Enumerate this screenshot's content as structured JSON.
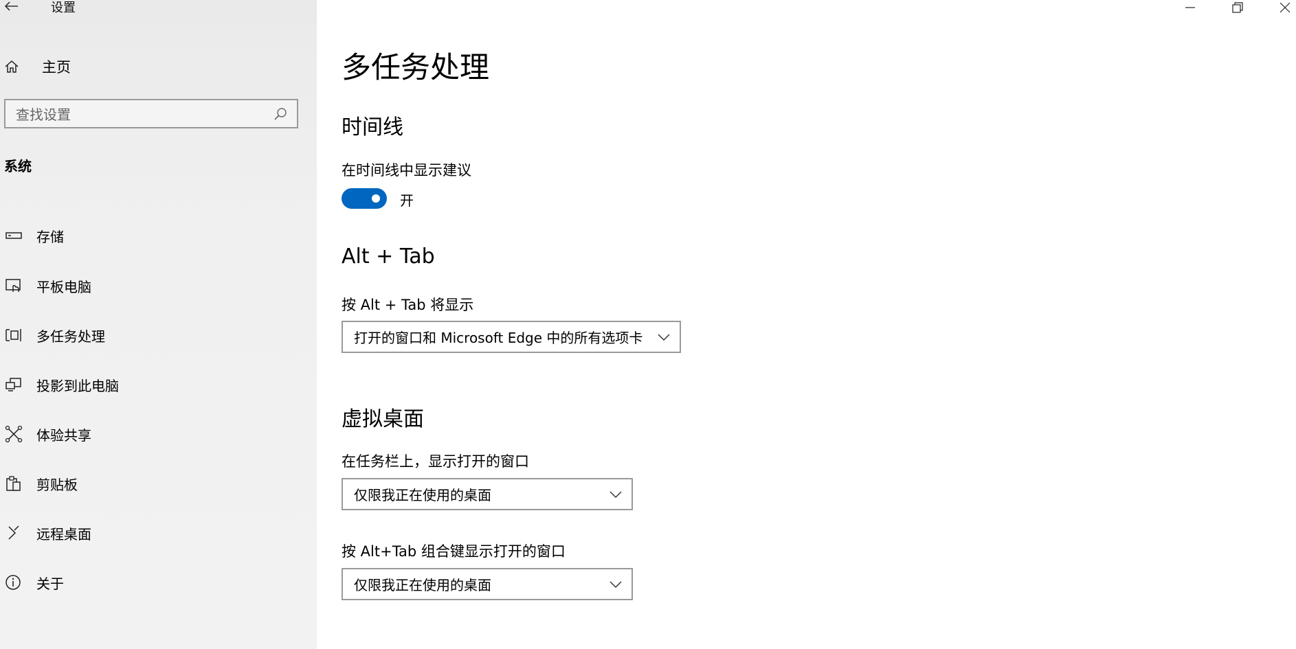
{
  "window": {
    "title": "设置",
    "controls": [
      "minimize-icon",
      "restore-icon",
      "close-icon"
    ]
  },
  "sidebar": {
    "home_label": "主页",
    "search_placeholder": "查找设置",
    "section_label": "系统",
    "items": [
      {
        "label": "存储",
        "icon": "storage-icon"
      },
      {
        "label": "平板电脑",
        "icon": "tablet-icon"
      },
      {
        "label": "多任务处理",
        "icon": "multitasking-icon"
      },
      {
        "label": "投影到此电脑",
        "icon": "project-icon"
      },
      {
        "label": "体验共享",
        "icon": "shared-experiences-icon"
      },
      {
        "label": "剪贴板",
        "icon": "clipboard-icon"
      },
      {
        "label": "远程桌面",
        "icon": "remote-desktop-icon"
      },
      {
        "label": "关于",
        "icon": "info-icon"
      }
    ]
  },
  "main": {
    "page_title": "多任务处理",
    "timeline": {
      "heading": "时间线",
      "suggestions_label": "在时间线中显示建议",
      "toggle_on": true,
      "toggle_state": "开",
      "accent_color": "#0067c0"
    },
    "alt_tab": {
      "heading": "Alt + Tab",
      "label": "按 Alt + Tab 将显示",
      "selected": "打开的窗口和 Microsoft Edge 中的所有选项卡"
    },
    "virtual_desktops": {
      "heading": "虚拟桌面",
      "taskbar_label": "在任务栏上，显示打开的窗口",
      "taskbar_selected": "仅限我正在使用的桌面",
      "alttab_label": "按 Alt+Tab 组合键显示打开的窗口",
      "alttab_selected": "仅限我正在使用的桌面"
    }
  }
}
